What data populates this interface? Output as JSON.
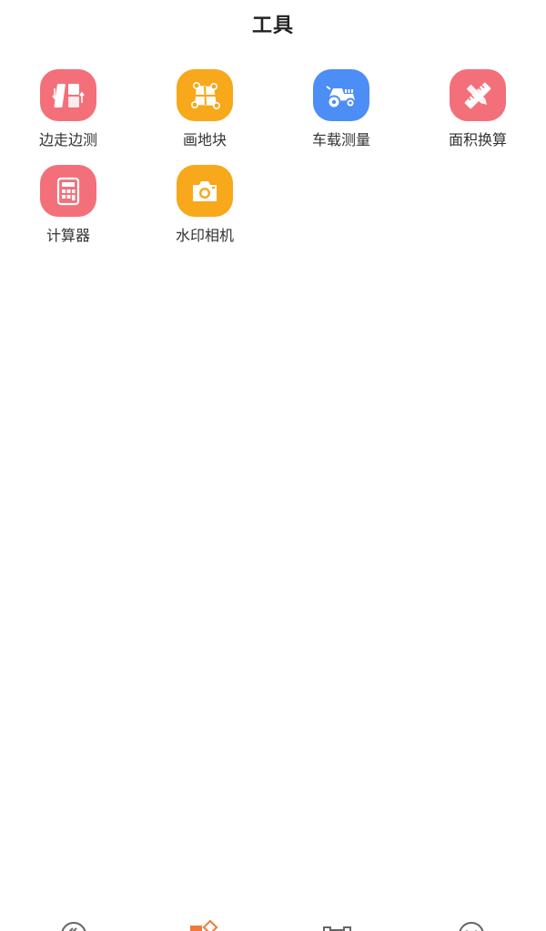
{
  "header": {
    "title": "工具"
  },
  "colors": {
    "pink": "#f3707a",
    "orange": "#f7a81b",
    "blue": "#4c8ef5",
    "tab_active": "#f07a3a",
    "tab_inactive": "#666666"
  },
  "tools": [
    {
      "label": "边走边测",
      "icon": "walk-measure-icon",
      "color": "#f3707a"
    },
    {
      "label": "画地块",
      "icon": "draw-plot-icon",
      "color": "#f7a81b"
    },
    {
      "label": "车载测量",
      "icon": "tractor-icon",
      "color": "#4c8ef5"
    },
    {
      "label": "面积换算",
      "icon": "ruler-pencil-icon",
      "color": "#f3707a"
    },
    {
      "label": "计算器",
      "icon": "calculator-icon",
      "color": "#f3707a"
    },
    {
      "label": "水印相机",
      "icon": "camera-icon",
      "color": "#f7a81b"
    }
  ],
  "tabbar": {
    "tabs": [
      {
        "icon": "home-tab-icon",
        "active": false
      },
      {
        "icon": "tools-tab-icon",
        "active": true
      },
      {
        "icon": "plots-tab-icon",
        "active": false
      },
      {
        "icon": "profile-tab-icon",
        "active": false
      }
    ]
  }
}
